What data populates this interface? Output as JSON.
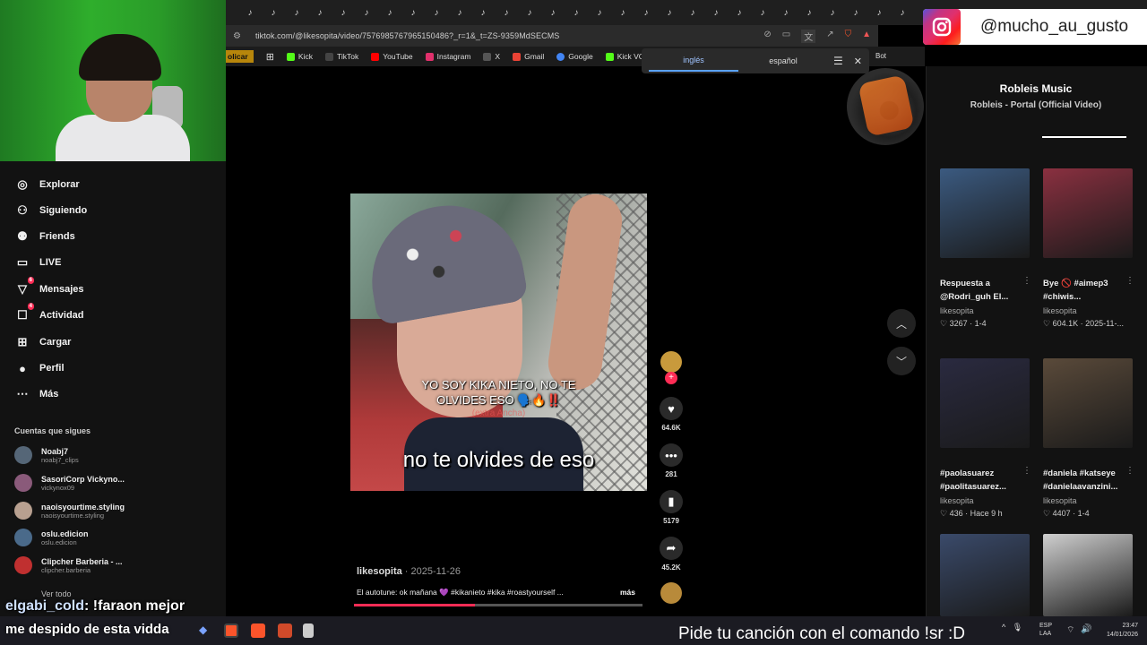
{
  "browser": {
    "url": "tiktok.com/@likesopita/video/7576985767965150486?_r=1&_t=ZS-9359MdSECMS",
    "bookmarks": [
      {
        "label": "olicar",
        "color": "#b7860b"
      },
      {
        "label": "Kick",
        "color": "#53fc18"
      },
      {
        "label": "TikTok",
        "color": "#111111"
      },
      {
        "label": "YouTube",
        "color": "#ff0000"
      },
      {
        "label": "Instagram",
        "color": "#e1306c"
      },
      {
        "label": "X",
        "color": "#000000"
      },
      {
        "label": "Gmail",
        "color": "#ea4335"
      },
      {
        "label": "Google",
        "color": "#4285f4"
      },
      {
        "label": "Kick VOD Dow",
        "color": "#53fc18"
      }
    ],
    "bot_label": "Bot"
  },
  "translate": {
    "lang1": "inglés",
    "lang2": "español"
  },
  "sidebar": {
    "items": [
      {
        "label": "Explorar",
        "icon": "compass-icon",
        "glyph": "◎"
      },
      {
        "label": "Siguiendo",
        "icon": "following-icon",
        "glyph": "⚇"
      },
      {
        "label": "Friends",
        "icon": "friends-icon",
        "glyph": "⚉"
      },
      {
        "label": "LIVE",
        "icon": "live-icon",
        "glyph": "▭"
      },
      {
        "label": "Mensajes",
        "icon": "messages-icon",
        "glyph": "▽",
        "badge": "6"
      },
      {
        "label": "Actividad",
        "icon": "activity-icon",
        "glyph": "☐",
        "badge": "4"
      },
      {
        "label": "Cargar",
        "icon": "upload-icon",
        "glyph": "⊞"
      },
      {
        "label": "Perfil",
        "icon": "profile-icon",
        "glyph": "●"
      },
      {
        "label": "Más",
        "icon": "more-icon",
        "glyph": "⋯"
      }
    ],
    "following_title": "Cuentas que sigues",
    "accounts": [
      {
        "name": "Noabj7",
        "handle": "noabj7_clips",
        "color": "#556677"
      },
      {
        "name": "SasoriCorp Vickyno...",
        "handle": "vickynox09",
        "color": "#8a5a7a"
      },
      {
        "name": "naoisyourtime.styling",
        "handle": "naoisyourtime.styling",
        "color": "#b8a090"
      },
      {
        "name": "oslu.edicion",
        "handle": "oslu.edicion",
        "color": "#4a6a8a"
      },
      {
        "name": "Clipcher Barberia - ...",
        "handle": "clipcher.barberia",
        "color": "#c03030"
      }
    ],
    "see_all": "Ver todo"
  },
  "chat": {
    "user": "elgabi_cold",
    "message": ": !faraon mejor",
    "line2": "me despido de esta vidda"
  },
  "video": {
    "caption_line1": "YO SOY KIKA NIETO, NO TE",
    "caption_line2": "OLVIDES ESO 🗣️🔥‼️",
    "caption_faded": "(extra Ancha)",
    "subtitle": "no te olvides de eso",
    "author": "likesopita",
    "date": " · 2025-11-26",
    "description": "El autotune: ok mañana 💜 #kikanieto #kika #roastyourself ...",
    "more": "más",
    "progress": 0.42
  },
  "actions": {
    "likes": "64.6K",
    "comments": "281",
    "saves": "5179",
    "shares": "45.2K"
  },
  "instagram": {
    "handle": "@mucho_au_gusto"
  },
  "music": {
    "title": "Robleis Music",
    "subtitle": "Robleis - Portal (Official Video)"
  },
  "related": [
    {
      "title1": "Respuesta a",
      "title2": "@Rodri_guh El...",
      "author": "likesopita",
      "stats": "♡ 3267 · 1-4",
      "color": "#3b5a80"
    },
    {
      "title1": "Bye 🚫 #aimep3",
      "title2": "#chiwis...",
      "author": "likesopita",
      "stats": "♡ 604.1K · 2025-11-...",
      "color": "#8a3040"
    },
    {
      "title1": "#paolasuarez",
      "title2": "#paolitasuarez...",
      "author": "likesopita",
      "stats": "♡ 436 · Hace 9 h",
      "color": "#2a2a40"
    },
    {
      "title1": "#daniela #katseye",
      "title2": "#danielaavanzini...",
      "author": "likesopita",
      "stats": "♡ 4407 · 1-4",
      "color": "#5a4a3a"
    },
    {
      "color": "#3a4a6a"
    },
    {
      "color": "#cfcfcf"
    }
  ],
  "taskbar": {
    "sr_text": "Pide tu canción con el comando !sr :D",
    "lang1": "ESP",
    "lang2": "LAA",
    "time": "23:47",
    "date": "14/01/2026"
  }
}
